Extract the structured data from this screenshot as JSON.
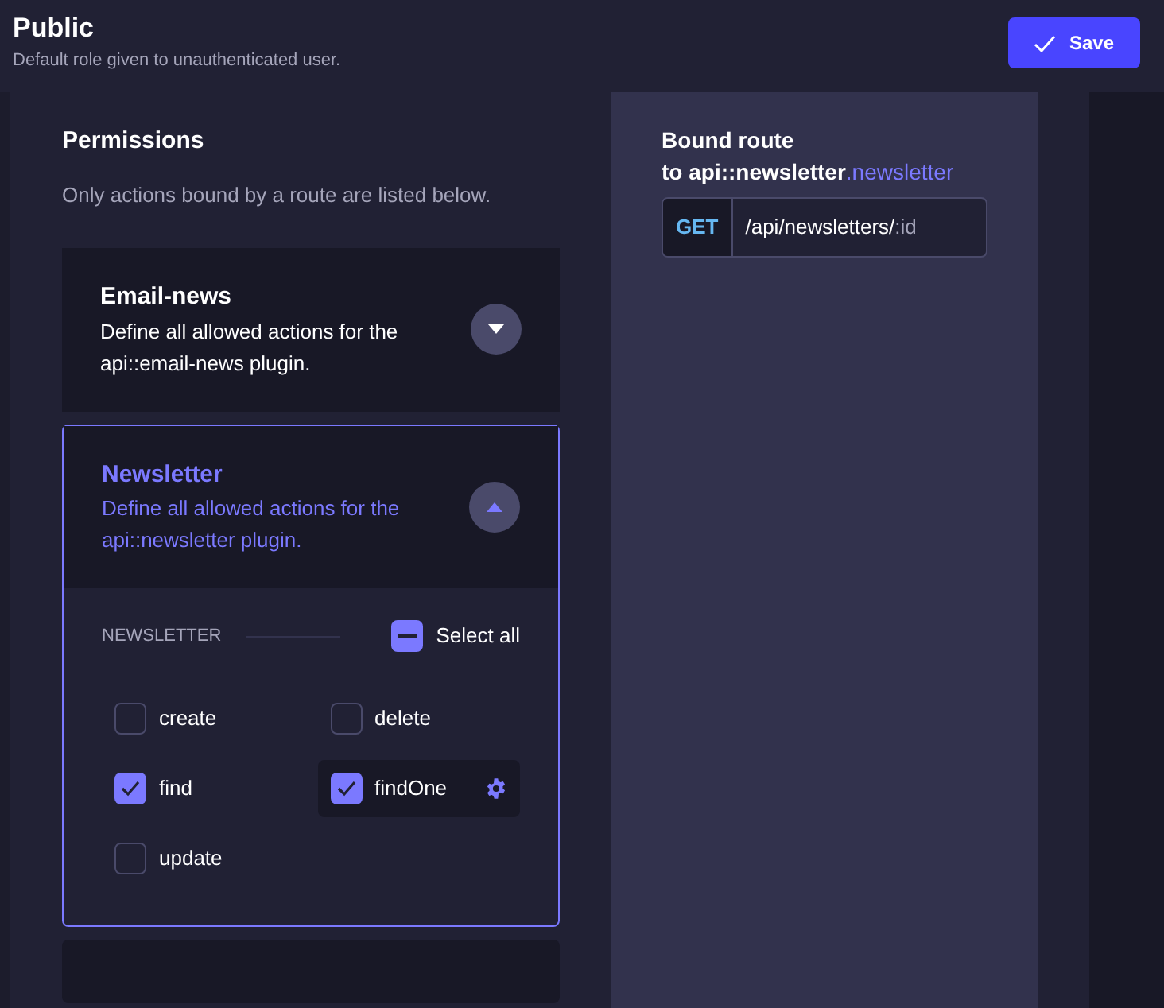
{
  "header": {
    "title": "Public",
    "subtitle": "Default role given to unauthenticated user.",
    "save_button": "Save"
  },
  "permissions": {
    "title": "Permissions",
    "subtitle": "Only actions bound by a route are listed below.",
    "plugins": [
      {
        "name": "Email-news",
        "description": "Define all allowed actions for the api::email-news plugin.",
        "expanded": false
      },
      {
        "name": "Newsletter",
        "description": "Define all allowed actions for the api::newsletter plugin.",
        "expanded": true,
        "section": {
          "label": "NEWSLETTER",
          "select_all": "Select all",
          "select_all_indeterminate": true,
          "actions": [
            {
              "label": "create",
              "checked": false,
              "selected": false
            },
            {
              "label": "delete",
              "checked": false,
              "selected": false
            },
            {
              "label": "find",
              "checked": true,
              "selected": false
            },
            {
              "label": "findOne",
              "checked": true,
              "selected": true
            },
            {
              "label": "update",
              "checked": false,
              "selected": false
            }
          ]
        }
      }
    ]
  },
  "bound_route": {
    "title": "Bound route",
    "target": "to api::newsletter",
    "target_highlight": ".newsletter",
    "method": "GET",
    "path": "/api/newsletters/",
    "param": ":id"
  }
}
